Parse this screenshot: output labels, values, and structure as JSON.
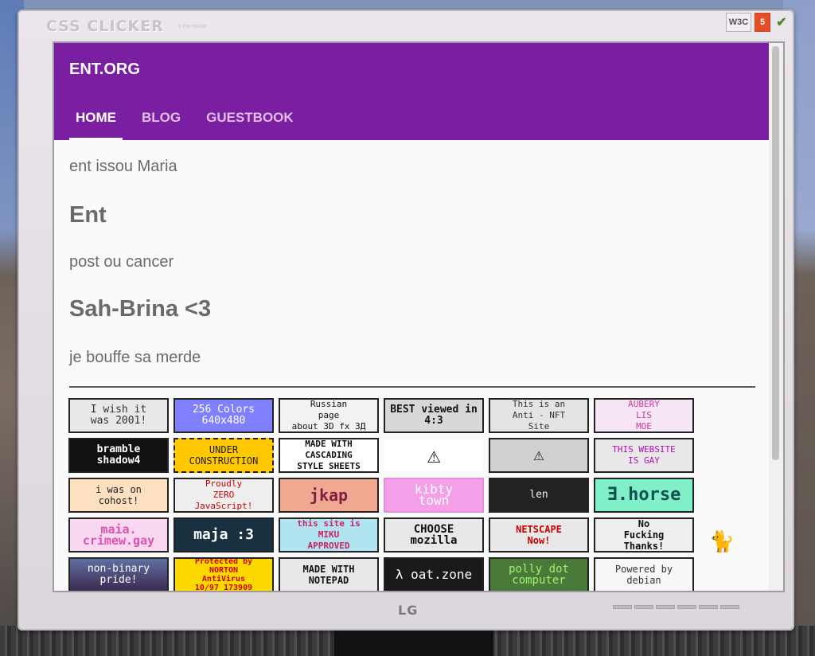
{
  "bezel": {
    "title": "CSS CLICKER",
    "subtitle": "v the sense",
    "brand": "LG",
    "icons": [
      "w3c-icon",
      "html5-icon",
      "check-icon"
    ],
    "w3c_text": "W3C",
    "html5_text": "5"
  },
  "site": {
    "title": "ENT.ORG",
    "tabs": [
      {
        "label": "HOME",
        "active": true
      },
      {
        "label": "BLOG",
        "active": false
      },
      {
        "label": "GUESTBOOK",
        "active": false
      }
    ],
    "lines": {
      "p1": "ent issou Maria",
      "h1": "Ent",
      "p2": "post ou cancer",
      "h2": "Sah-Brina <3",
      "p3": "je bouffe sa merde"
    }
  },
  "badges": [
    [
      "I wish it\nwas 2001!",
      "256 Colors\n640x480",
      "Russian\npage\nabout 3D fx  3Д",
      "BEST viewed in\n4:3",
      "This is an\nAnti - NFT\nSite",
      "AUBERY\nLIS\nMOE"
    ],
    [
      "bramble\nshadow4",
      "UNDER\nCONSTRUCTION",
      "MADE WITH\nCASCADING\nSTYLE SHEETS",
      "⚠",
      "⚠",
      "THIS WEBSITE\nIS GAY"
    ],
    [
      "i was on\ncohost!",
      "Proudly\nZERO\nJavaScript!",
      "jkap",
      "kibty\ntown",
      "len",
      "Ǝ.horse"
    ],
    [
      "maia.\ncrimew.gay",
      "maja :3",
      "this site is\nMIKU\nAPPROVED",
      "CHOOSE\nmozilla",
      "NETSCAPE\nNow!",
      "No\nFucking\nThanks!"
    ],
    [
      "non-binary\npride!",
      "Protected by\nNORTON\nAntiVirus\n10/97 173909",
      "MADE WITH\nNOTEPAD",
      "λ oat.zone",
      "polly dot\ncomputer",
      "Powered by\ndebian"
    ]
  ],
  "colors": {
    "accent": "#7b1fa2",
    "tab_inactive": "#e1bee7",
    "text": "#6b6b6b"
  }
}
